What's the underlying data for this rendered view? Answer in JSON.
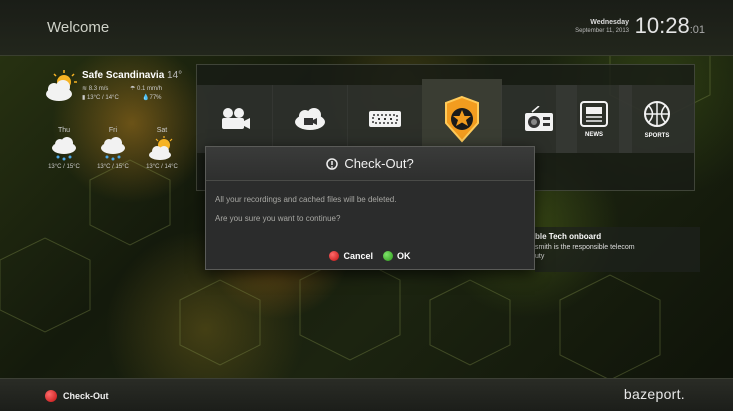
{
  "header": {
    "title": "Welcome",
    "date_weekday": "Wednesday",
    "date_full": "September 11, 2013",
    "time_main": "10:28",
    "time_seconds": ":01"
  },
  "weather": {
    "location": "Safe Scandinavia",
    "current_temp": "14°",
    "wind": "8.3 m/s",
    "rain": "0.1 mm/h",
    "range": "13°C / 14°C",
    "humidity": "77%",
    "forecast": [
      {
        "day": "Thu",
        "temp": "13°C / 15°C",
        "icon": "rain-cloud-icon"
      },
      {
        "day": "Fri",
        "temp": "13°C / 15°C",
        "icon": "rain-cloud-icon"
      },
      {
        "day": "Sat",
        "temp": "13°C / 14°C",
        "icon": "sun-cloud-icon"
      }
    ]
  },
  "menu": {
    "tiles": [
      {
        "icon": "movie-camera-icon",
        "label": ""
      },
      {
        "icon": "cloud-camera-icon",
        "label": ""
      },
      {
        "icon": "ticket-icon",
        "label": ""
      },
      {
        "icon": "police-badge-icon",
        "label": "",
        "active": true
      },
      {
        "icon": "radio-icon",
        "label": ""
      },
      {
        "icon": "news-icon",
        "label": "NEWS"
      },
      {
        "icon": "sports-ball-icon",
        "label": "SPORTS"
      }
    ]
  },
  "dialog": {
    "title": "Check-Out?",
    "message_1": "All your recordings and cached files will be deleted.",
    "message_2": "Are you sure you want to continue?",
    "cancel_label": "Cancel",
    "ok_label": "OK"
  },
  "news": {
    "title": "ble Tech onboard",
    "body_1": "smith is the responsible telecom",
    "body_2": "uty"
  },
  "footer": {
    "checkout_label": "Check-Out",
    "brand": "bazeport."
  },
  "colors": {
    "accent_orange": "#f0a020",
    "cancel_red": "#d02020",
    "ok_green": "#3ab020"
  }
}
